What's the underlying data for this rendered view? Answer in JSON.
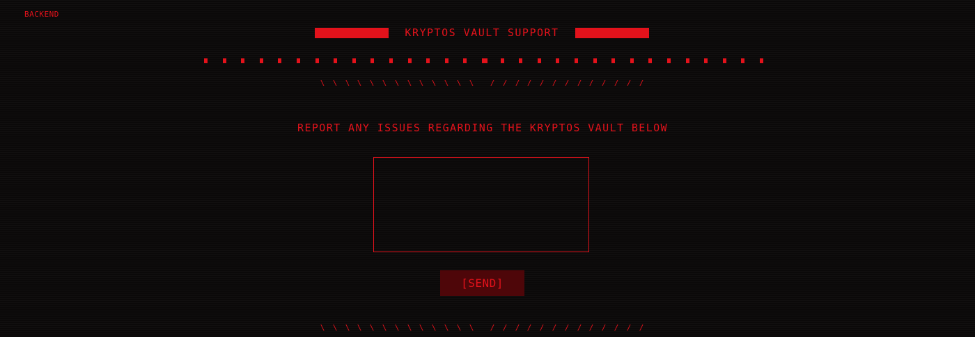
{
  "nav": {
    "backend_label": "BACKEND"
  },
  "header": {
    "title": "KRYPTOS VAULT SUPPORT"
  },
  "main": {
    "instruction": "REPORT ANY ISSUES REGARDING THE KRYPTOS VAULT BELOW",
    "issue_field_value": "",
    "send_label": "[SEND]"
  },
  "decor": {
    "slash_left": "\\",
    "slash_right": "/"
  },
  "colors": {
    "background": "#0b0909",
    "accent": "#e3121b",
    "button_bg": "#4e0609"
  }
}
